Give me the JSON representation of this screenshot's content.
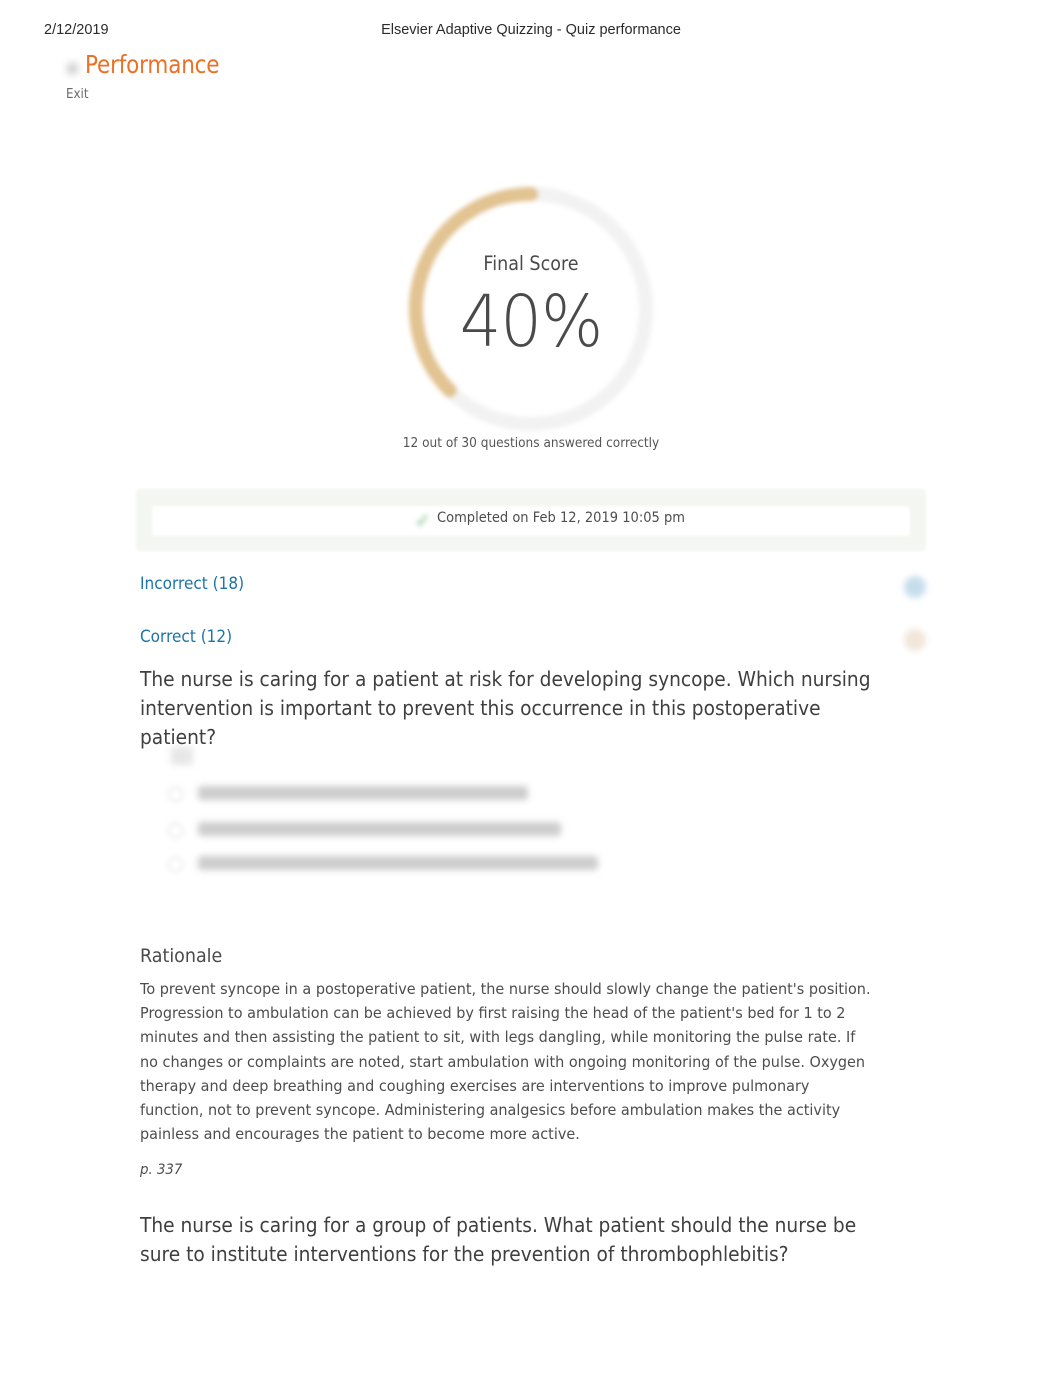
{
  "print_header": {
    "date": "2/12/2019",
    "title": "Elsevier Adaptive Quizzing - Quiz performance"
  },
  "appbar": {
    "logo_icon": "app-logo-icon",
    "title": "Performance",
    "exit_label": "Exit"
  },
  "score": {
    "caption": "Final Score",
    "value": "40%",
    "percent": 40,
    "subtext": "12 out of 30 questions answered correctly",
    "ring_progress_color": "#e0c08a",
    "ring_track_color": "#f0f0f0"
  },
  "completed": {
    "check_icon": "green-check-icon",
    "text": "Completed on Feb 12, 2019 10:05 pm"
  },
  "filters": [
    {
      "label": "Incorrect (18)",
      "count": 18,
      "badge_icon": "incorrect-badge-icon",
      "badge_color": "#96c3dc"
    },
    {
      "label": "Correct (12)",
      "count": 12,
      "badge_icon": "correct-badge-icon",
      "badge_color": "#dcc3a0"
    }
  ],
  "questions": [
    {
      "text": "The nurse is caring for a patient at risk for developing syncope. Which nursing intervention is important to prevent this occurrence in this postoperative patient?",
      "options_redacted": true,
      "rationale_heading": "Rationale",
      "rationale": "To prevent syncope in a postoperative patient, the nurse should slowly change the patient's position. Progression to ambulation can be achieved by first raising the head of the patient's bed for 1 to 2 minutes and then assisting the patient to sit, with legs dangling, while monitoring the pulse rate. If no changes or complaints are noted, start ambulation with ongoing monitoring of the pulse. Oxygen therapy and deep breathing and coughing exercises are interventions to improve pulmonary function, not to prevent syncope. Administering analgesics before ambulation makes the activity painless and encourages the patient to become more active.",
      "page_reference": "p. 337"
    },
    {
      "text": "The nurse is caring for a group of patients. What patient should the nurse be sure to institute interventions for the prevention of thrombophlebitis?"
    }
  ],
  "theme": {
    "brand_orange": "#ea7125",
    "link_blue": "#1c74a8",
    "body_text": "#4d4d4d"
  }
}
